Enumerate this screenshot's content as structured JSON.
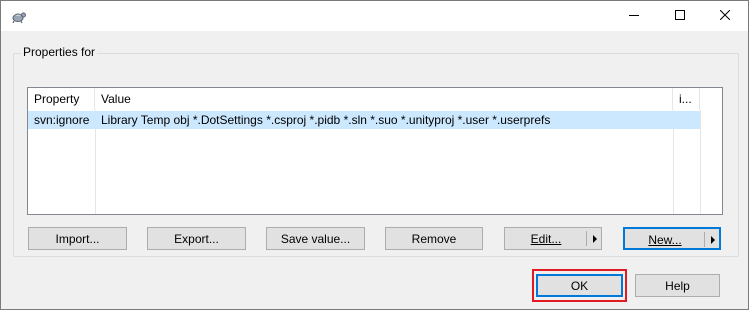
{
  "window": {
    "title": "",
    "app_icon": "tortoise-icon",
    "controls": {
      "minimize": "minimize-icon",
      "maximize": "maximize-icon",
      "close": "close-icon"
    }
  },
  "group": {
    "label": "Properties for"
  },
  "table": {
    "columns": [
      "Property",
      "Value",
      "i..."
    ],
    "rows": [
      {
        "property": "svn:ignore",
        "value": "Library Temp obj *.DotSettings *.csproj *.pidb *.sln *.suo *.unityproj *.user *.userprefs",
        "extra": "",
        "selected": true
      }
    ]
  },
  "buttons": {
    "import": "Import...",
    "export": "Export...",
    "save_value": "Save value...",
    "remove": "Remove",
    "edit": "Edit...",
    "new": "New..."
  },
  "dialog_buttons": {
    "ok": "OK",
    "help": "Help"
  },
  "colors": {
    "selection": "#cce8ff",
    "default_button_border": "#0078d7",
    "annotation_box": "#e21b23"
  }
}
